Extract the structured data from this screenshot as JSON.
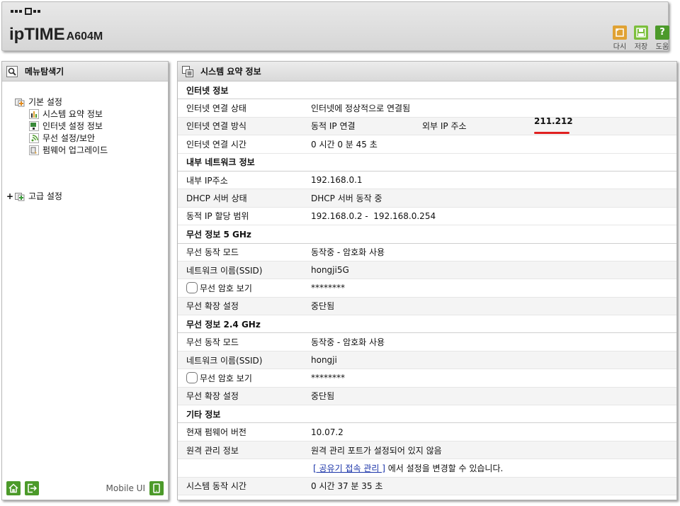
{
  "header": {
    "brand": "ipTIME",
    "model": "A604M",
    "buttons": [
      {
        "label": "다시",
        "icon": "undo-icon",
        "color": "#e0a233"
      },
      {
        "label": "저장",
        "icon": "save-icon",
        "color": "#7cbf3c"
      },
      {
        "label": "도움",
        "icon": "help-icon",
        "color": "#4c9a2a"
      }
    ]
  },
  "sidebar": {
    "title": "메뉴탐색기",
    "basic": {
      "label": "기본 설정",
      "items": [
        "시스템 요약 정보",
        "인터넷 설정 정보",
        "무선 설정/보안",
        "펌웨어 업그레이드"
      ]
    },
    "advanced": {
      "expander": "+",
      "label": "고급 설정"
    },
    "mobile_ui": "Mobile UI"
  },
  "main": {
    "title": "시스템 요약 정보",
    "internet": {
      "section": "인터넷 정보",
      "status_label": "인터넷 연결 상태",
      "status_value": "인터넷에 정상적으로 연결됨",
      "method_label": "인터넷 연결 방식",
      "method_value": "동적 IP 연결",
      "ext_ip_label": "외부 IP 주소",
      "ext_ip_value": "211.212",
      "time_label": "인터넷 연결 시간",
      "time_value": "0 시간 0 분 45 초"
    },
    "lan": {
      "section": "내부 네트워크 정보",
      "ip_label": "내부 IP주소",
      "ip_value": "192.168.0.1",
      "dhcp_label": "DHCP 서버 상태",
      "dhcp_value": "DHCP 서버 동작 중",
      "range_label": "동적 IP 할당 범위",
      "range_value": "192.168.0.2 -  192.168.0.254"
    },
    "wifi5": {
      "section": "무선 정보 5 GHz",
      "mode_label": "무선 동작 모드",
      "mode_value": "동작중 - 암호화 사용",
      "ssid_label": "네트워크 이름(SSID)",
      "ssid_value": "hongji5G",
      "pw_label": "무선 암호 보기",
      "pw_value": "********",
      "ext_label": "무선 확장 설정",
      "ext_value": "중단됨"
    },
    "wifi24": {
      "section": "무선 정보 2.4 GHz",
      "mode_label": "무선 동작 모드",
      "mode_value": "동작중 - 암호화 사용",
      "ssid_label": "네트워크 이름(SSID)",
      "ssid_value": "hongji",
      "pw_label": "무선 암호 보기",
      "pw_value": "********",
      "ext_label": "무선 확장 설정",
      "ext_value": "중단됨"
    },
    "etc": {
      "section": "기타 정보",
      "fw_label": "현재 펌웨어 버전",
      "fw_value": "10.07.2",
      "remote_label": "원격 관리 정보",
      "remote_value": "원격 관리 포트가 설정되어 있지 않음",
      "remote_link": "[ 공유기 접속 관리 ]",
      "remote_suffix": " 에서 설정을 변경할 수 있습니다.",
      "uptime_label": "시스템 동작 시간",
      "uptime_value": "0 시간 37 분 35 초"
    }
  }
}
